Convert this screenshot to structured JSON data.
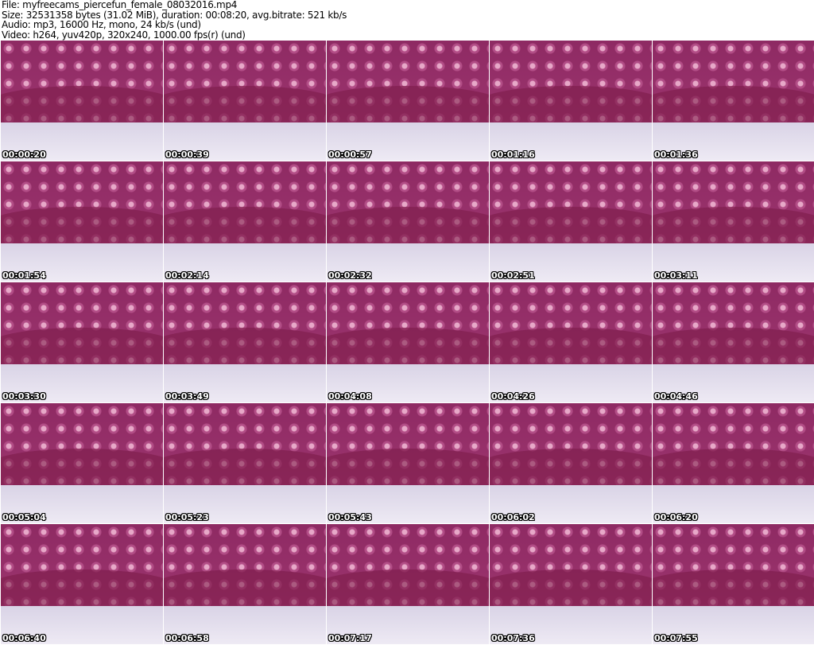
{
  "header": {
    "file": "File: myfreecams_piercefun_female_08032016.mp4",
    "size": "Size: 32531358 bytes (31.02 MiB), duration: 00:08:20, avg.bitrate: 521 kb/s",
    "audio": "Audio: mp3, 16000 Hz, mono, 24 kb/s (und)",
    "video": "Video: h264, yuv420p, 320x240, 1000.00 fps(r) (und)"
  },
  "thumbnails": [
    "00:00:20",
    "00:00:39",
    "00:00:57",
    "00:01:16",
    "00:01:36",
    "00:01:54",
    "00:02:14",
    "00:02:32",
    "00:02:51",
    "00:03:11",
    "00:03:30",
    "00:03:49",
    "00:04:08",
    "00:04:26",
    "00:04:46",
    "00:05:04",
    "00:05:23",
    "00:05:43",
    "00:06:02",
    "00:06:20",
    "00:06:40",
    "00:06:58",
    "00:07:17",
    "00:07:36",
    "00:07:55"
  ]
}
